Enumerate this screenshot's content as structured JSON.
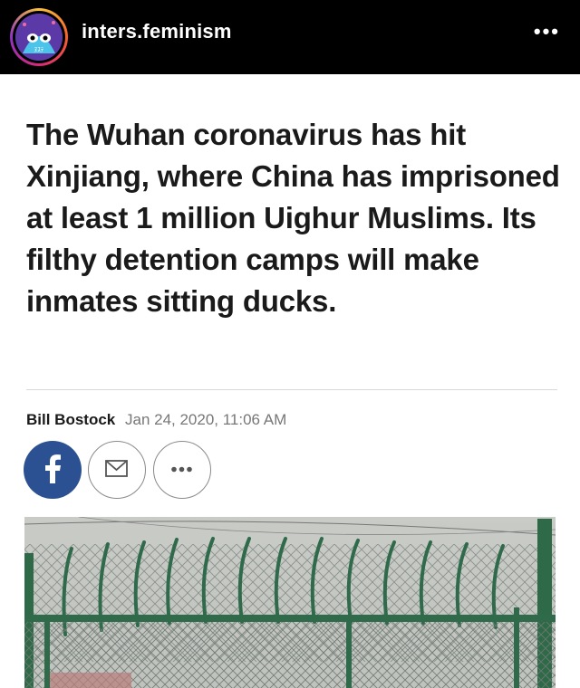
{
  "header": {
    "username": "inters.feminism",
    "avatar_icon": "cat-face-avatar-icon",
    "more_label": "•••"
  },
  "article": {
    "headline": "The Wuhan coronavirus has hit Xinjiang, where China has imprisoned at least 1 million Uighur Muslims. Its filthy detention camps will make inmates sitting ducks.",
    "author": "Bill Bostock",
    "date": "Jan 24, 2020, 11:06 AM",
    "share_buttons": [
      {
        "name": "facebook",
        "icon": "facebook-icon"
      },
      {
        "name": "email",
        "icon": "envelope-icon"
      },
      {
        "name": "more",
        "icon": "ellipsis-icon"
      }
    ],
    "photo": {
      "subject": "barbed-wire-fence-image"
    }
  },
  "colors": {
    "header_bg": "#000000",
    "facebook_blue": "#2b5193",
    "fence_green": "#2f6a4a"
  }
}
